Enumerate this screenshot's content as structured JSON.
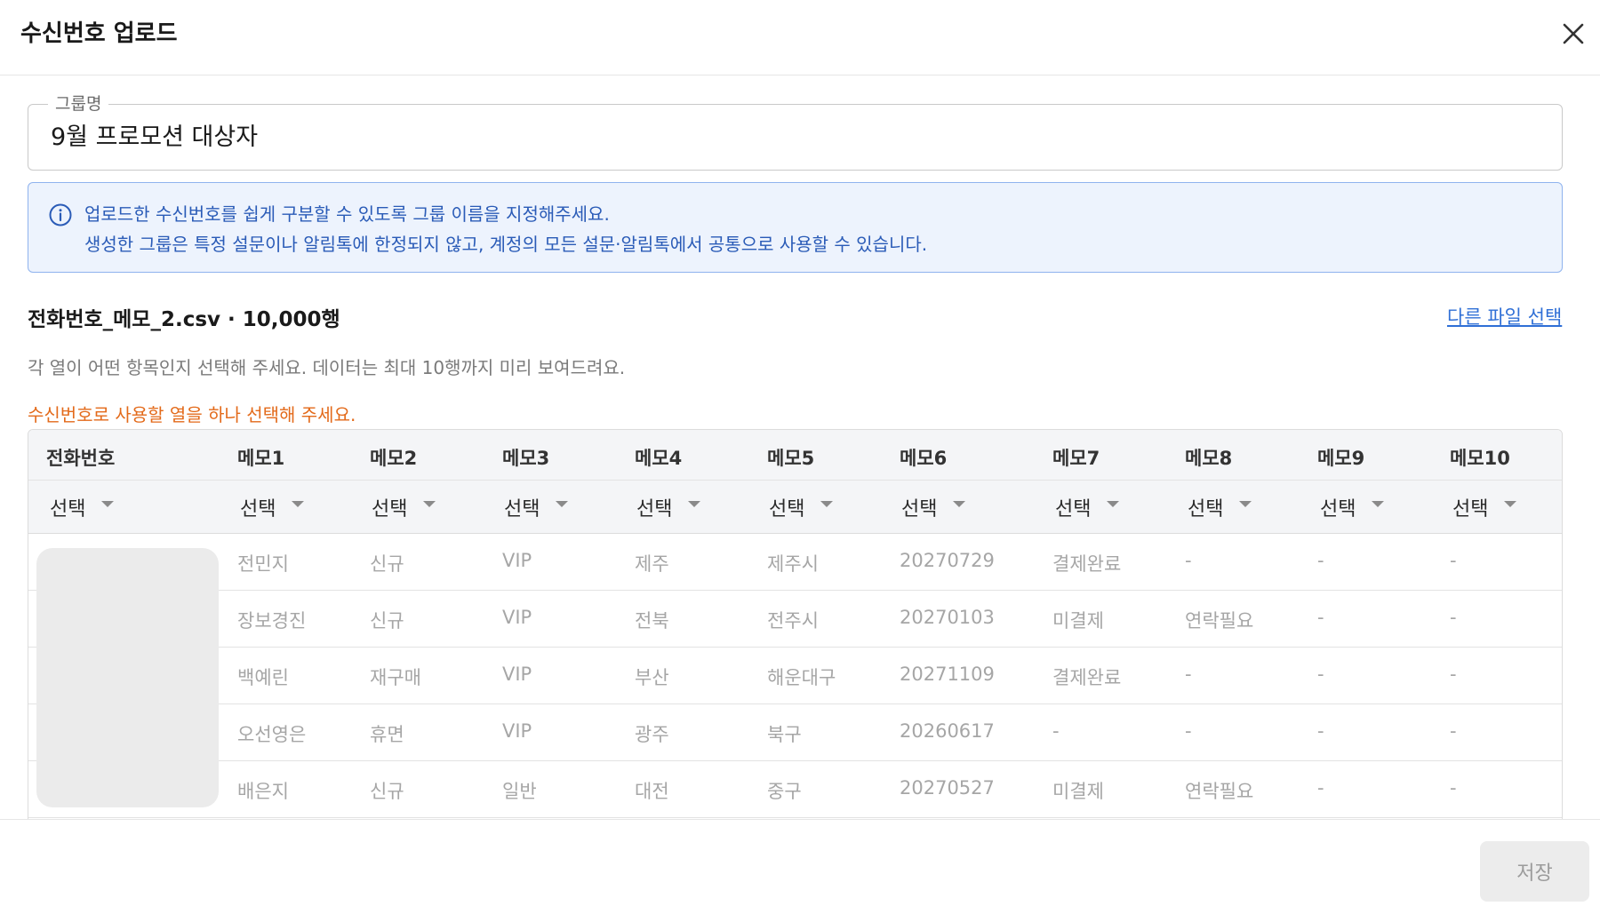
{
  "header": {
    "title": "수신번호 업로드",
    "close_icon": "close-icon"
  },
  "group_field": {
    "label": "그룹명",
    "value": "9월 프로모션 대상자"
  },
  "info": {
    "icon": "info-icon",
    "line1": "업로드한 수신번호를 쉽게 구분할 수 있도록 그룹 이름을 지정해주세요.",
    "line2": "생성한 그룹은 특정 설문이나 알림톡에 한정되지 않고, 계정의 모든 설문·알림톡에서 공통으로 사용할 수 있습니다."
  },
  "file": {
    "name": "전화번호_메모_2.csv · 10,000행",
    "change_link": "다른 파일 선택"
  },
  "description": "각 열이 어떤 항목인지 선택해 주세요. 데이터는 최대 10행까지 미리 보여드려요.",
  "warning": "수신번호로 사용할 열을 하나 선택해 주세요.",
  "colors": {
    "accent": "#2f6fd6",
    "warning": "#e36a1a",
    "info_bg": "#edf3fd"
  },
  "table": {
    "columns": [
      "전화번호",
      "메모1",
      "메모2",
      "메모3",
      "메모4",
      "메모5",
      "메모6",
      "메모7",
      "메모8",
      "메모9",
      "메모10"
    ],
    "select_label": "선택",
    "rows": [
      [
        "",
        "전민지",
        "신규",
        "VIP",
        "제주",
        "제주시",
        "20270729",
        "결제완료",
        "-",
        "-",
        "-"
      ],
      [
        "",
        "장보경진",
        "신규",
        "VIP",
        "전북",
        "전주시",
        "20270103",
        "미결제",
        "연락필요",
        "-",
        "-"
      ],
      [
        "",
        "백예린",
        "재구매",
        "VIP",
        "부산",
        "해운대구",
        "20271109",
        "결제완료",
        "-",
        "-",
        "-"
      ],
      [
        "",
        "오선영은",
        "휴면",
        "VIP",
        "광주",
        "북구",
        "20260617",
        "-",
        "-",
        "-",
        "-"
      ],
      [
        "",
        "배은지",
        "신규",
        "일반",
        "대전",
        "중구",
        "20270527",
        "미결제",
        "연락필요",
        "-",
        "-"
      ]
    ]
  },
  "footer": {
    "save_label": "저장"
  }
}
